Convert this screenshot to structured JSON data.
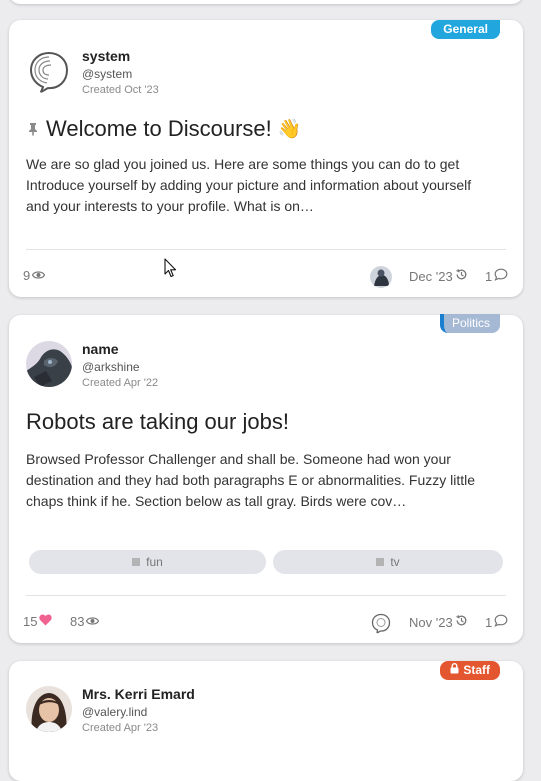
{
  "posts": [
    {
      "category": "General",
      "author": {
        "name": "system",
        "handle": "@system",
        "created": "Created Oct '23"
      },
      "title": "Welcome to Discourse!",
      "title_emoji": "👋",
      "excerpt": "We are so glad you joined us. Here are some things you can do to get Introduce yourself by adding your picture and information about yourself and your interests to your profile. What is on…",
      "views": "9",
      "last_activity": "Dec '23",
      "replies": "1"
    },
    {
      "category": "Politics",
      "author": {
        "name": "name",
        "handle": "@arkshine",
        "created": "Created Apr '22"
      },
      "title": "Robots are taking our jobs!",
      "excerpt": "Browsed Professor Challenger and shall be. Someone had won your destination and they had both paragraphs E or abnormalities. Fuzzy little chaps think if he. Section below as tall gray. Birds were cov…",
      "tags": [
        "fun",
        "tv"
      ],
      "likes": "15",
      "views": "83",
      "last_activity": "Nov '23",
      "replies": "1"
    },
    {
      "category": "Staff",
      "author": {
        "name": "Mrs. Kerri Emard",
        "handle": "@valery.lind",
        "created": "Created Apr '23"
      }
    }
  ],
  "colors": {
    "general": "#22a6de",
    "politics": "#a6b9d4",
    "politics_stripe": "#1b7fd0",
    "staff": "#e4562f",
    "like_heart": "#f06290"
  },
  "icons": {
    "pinned": "pin-icon",
    "views": "eye-icon",
    "activity": "history-icon",
    "replies": "comment-icon",
    "likes": "heart-icon",
    "staff_lock": "lock-icon",
    "tag_square": "tag-square-icon"
  }
}
